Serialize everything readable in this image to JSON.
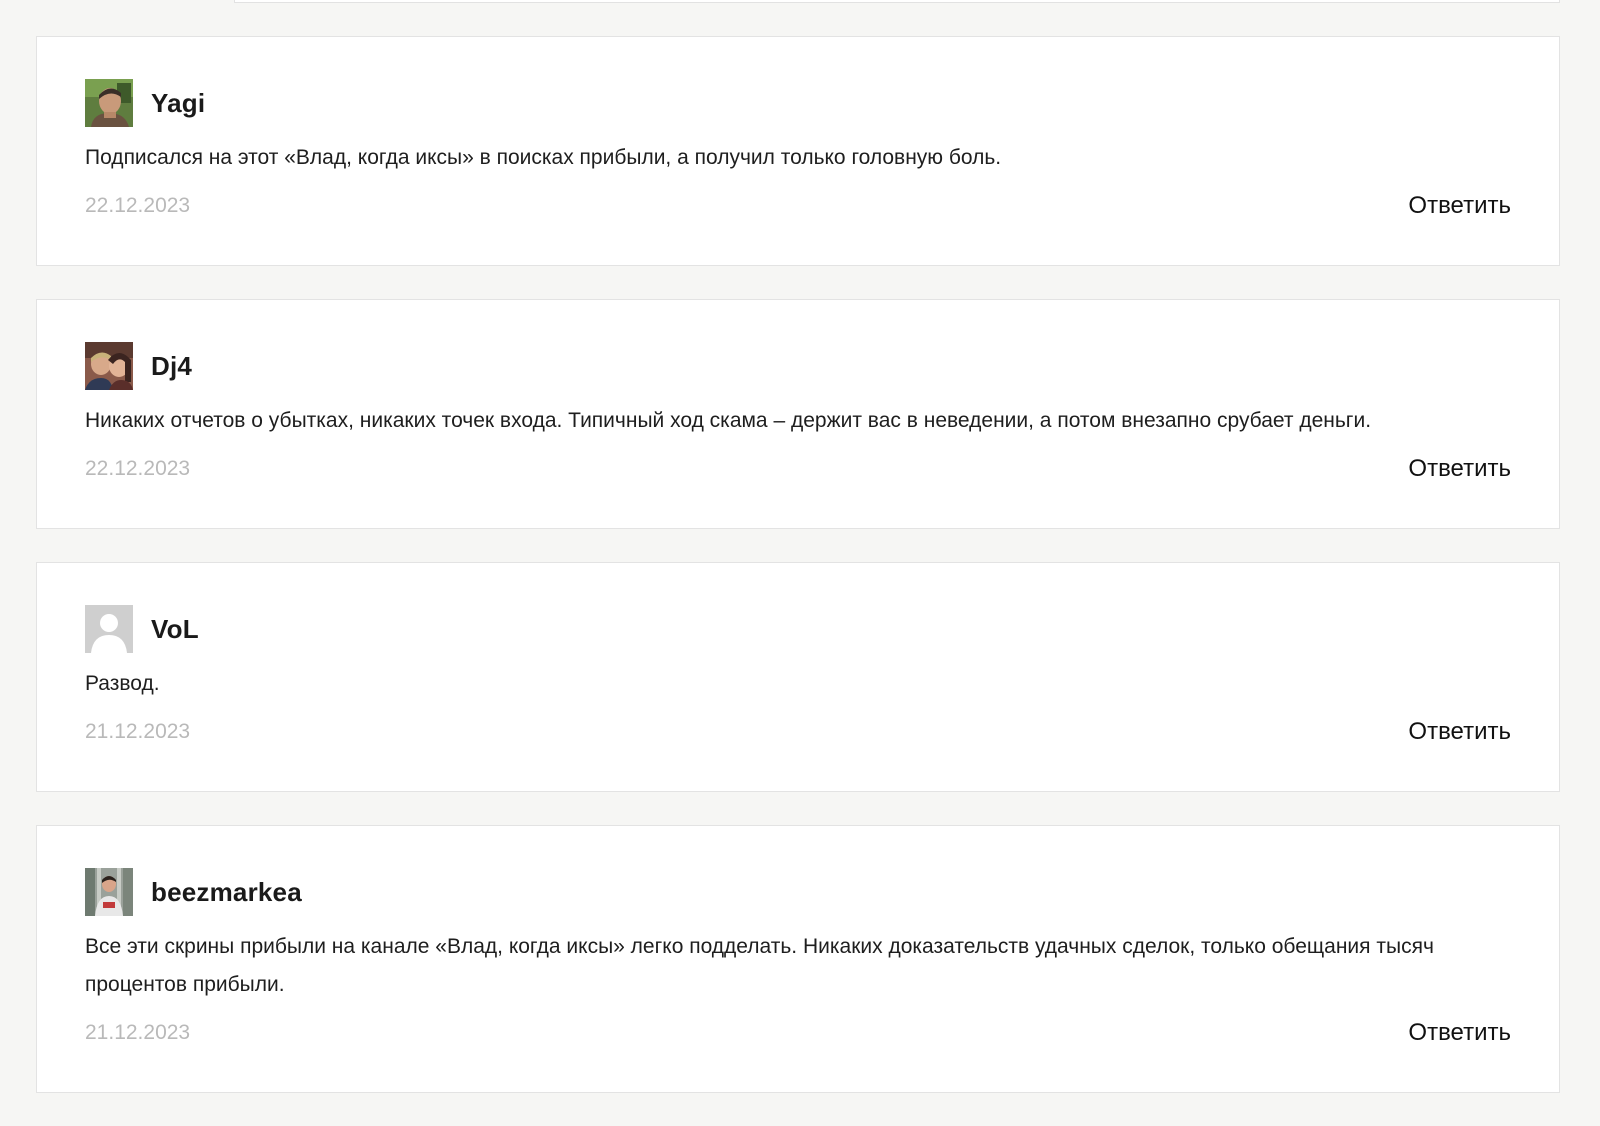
{
  "reply_label": "Ответить",
  "comments": [
    {
      "author": "Yagi",
      "avatar_icon": "user-photo-icon",
      "text": "Подписался на этот «Влад, когда иксы» в поисках прибыли, а получил только головную боль.",
      "date": "22.12.2023"
    },
    {
      "author": "Dj4",
      "avatar_icon": "user-photo-icon",
      "text": "Никаких отчетов о убытках, никаких точек входа. Типичный ход скама – держит вас в неведении, а потом внезапно срубает деньги.",
      "date": "22.12.2023"
    },
    {
      "author": "VoL",
      "avatar_icon": "default-avatar-icon",
      "text": "Развод.",
      "date": "21.12.2023"
    },
    {
      "author": "beezmarkea",
      "avatar_icon": "user-photo-icon",
      "text": "Все эти скрины прибыли на канале «Влад, когда иксы» легко подделать. Никаких доказательств удачных сделок, только обещания тысяч процентов прибыли.",
      "date": "21.12.2023"
    }
  ],
  "colors": {
    "page_background": "#f6f6f4",
    "card_background": "#ffffff",
    "card_border": "#e3e3e3",
    "date_text": "#b9b9b9",
    "body_text": "#1e1e1e"
  }
}
